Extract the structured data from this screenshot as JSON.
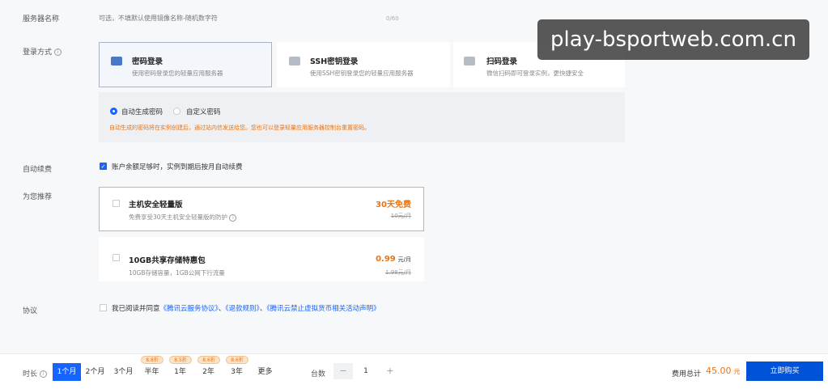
{
  "server_name": {
    "label": "服务器名称",
    "placeholder": "可选，不填默认使用镜像名称-随机数字符",
    "counter": "0/60"
  },
  "login_method": {
    "label": "登录方式",
    "options": [
      {
        "title": "密码登录",
        "desc": "使用密码登录您的轻量应用服务器",
        "selected": true
      },
      {
        "title": "SSH密钥登录",
        "desc": "使用SSH密钥登录您的轻量应用服务器",
        "selected": false
      },
      {
        "title": "扫码登录",
        "desc": "微信扫码即可登录实例，更快捷安全",
        "selected": false
      }
    ],
    "password_modes": [
      "自动生成密码",
      "自定义密码"
    ],
    "notice": "自动生成的密码将在实例创建后，通过站内信发送给您。您也可以登录轻量应用服务器控制台重置密码。"
  },
  "auto_renew": {
    "label": "自动续费",
    "text": "账户余额足够时，实例到期后按月自动续费",
    "checked": true
  },
  "recommend": {
    "label": "为您推荐",
    "items": [
      {
        "title": "主机安全轻量版",
        "desc": "免费享受30天主机安全轻量版的防护",
        "price": "30天免费",
        "price_unit": "",
        "orig": "10元/月"
      },
      {
        "title": "10GB共享存储特惠包",
        "desc": "10GB存储容量，1GB公网下行流量",
        "price": "0.99",
        "price_unit": "元/月",
        "orig": "1.98元/月"
      }
    ]
  },
  "agreement": {
    "label": "协议",
    "prefix": "我已阅读并同意",
    "link1": "《腾讯云服务协议》",
    "sep1": "、",
    "link2": "《退款规则》",
    "sep2": "、",
    "link3": "《腾讯云禁止虚拟货币相关活动声明》"
  },
  "footer": {
    "duration_label": "时长",
    "durations": [
      "1个月",
      "2个月",
      "3个月",
      "半年",
      "1年",
      "2年",
      "3年",
      "更多"
    ],
    "discounts": [
      "8.8折",
      "8.5折",
      "8.6折",
      "8.6折"
    ],
    "qty_label": "台数",
    "qty_minus": "−",
    "qty_value": "1",
    "qty_plus": "+",
    "total_label": "费用总计",
    "total_value": "45.00",
    "total_unit": "元",
    "buy_label": "立即购买"
  },
  "watermark": "play-bsportweb.com.cn",
  "colors": {
    "primary": "#1664ff",
    "buy": "#0052d9",
    "price": "#e6751a",
    "notice": "#e6751a"
  }
}
